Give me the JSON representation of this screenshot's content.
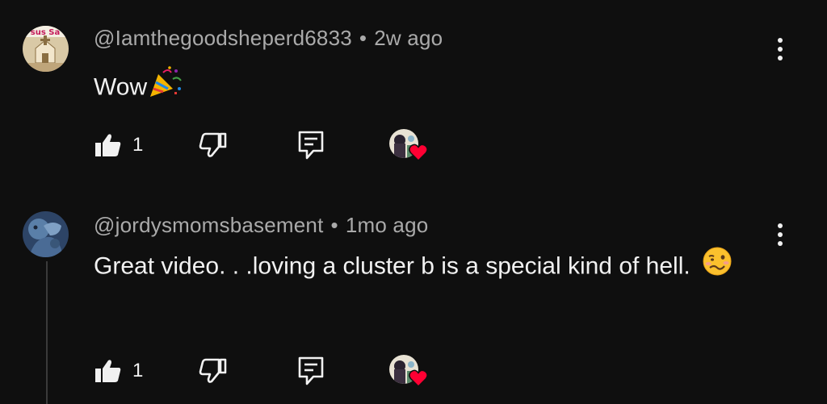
{
  "comments": [
    {
      "username": "@Iamthegoodsheperd6833",
      "time": "2w ago",
      "text": "Wow",
      "avatar_banner_text": "sus Sa",
      "likes": "1",
      "creator_heart": true
    },
    {
      "username": "@jordysmomsbasement",
      "time": "1mo ago",
      "text": "Great video. . .loving a cluster b is a special kind of hell.",
      "likes": "1",
      "creator_heart": true
    }
  ],
  "separator": "•",
  "icons": {
    "more": "more-vertical-icon",
    "like": "thumbs-up-icon",
    "dislike": "thumbs-down-icon",
    "reply": "reply-icon",
    "heart": "heart-icon",
    "party": "party-popper-emoji",
    "woozy": "woozy-face-emoji"
  },
  "colors": {
    "background": "#0f0f0f",
    "text": "#f1f1f1",
    "meta": "#aaaaaa",
    "heart": "#ff0033"
  }
}
